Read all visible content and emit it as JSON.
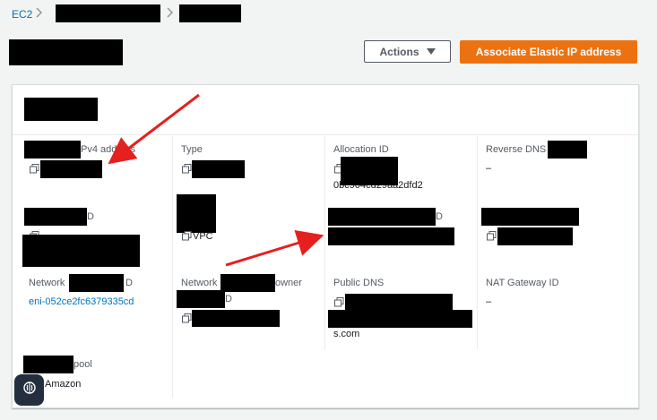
{
  "breadcrumb": {
    "root": "EC2"
  },
  "header": {
    "actions_label": "Actions",
    "primary_label": "Associate Elastic IP address"
  },
  "fields": {
    "public_ipv4_label_tail": "Pv4 address",
    "type_label": "Type",
    "allocation_id_label": "Allocation ID",
    "allocation_id_value": "0bc904cd29aa2dfd2",
    "reverse_dns_label": "Reverse DNS",
    "reverse_dns_value": "–",
    "assoc_id_label_tail": "D",
    "scope_value": "VPC",
    "priv_ip_label_tail": "D",
    "network_interface_label_head": "Network",
    "network_interface_label_tail": "D",
    "network_interface_value": "eni-052ce2fc6379335cd",
    "network_owner_label_head": "Network",
    "network_owner_label_tail": "owner",
    "network_owner_sub_tail": "D",
    "public_dns_label": "Public DNS",
    "public_dns_value_tail": "s.com",
    "nat_gateway_label": "NAT Gateway ID",
    "nat_gateway_value": "–",
    "pool_label_tail": "pool",
    "pool_value": "Amazon"
  },
  "colors": {
    "link": "#0073bb",
    "primary": "#ec7211",
    "annotation_arrow": "#e5201e"
  }
}
